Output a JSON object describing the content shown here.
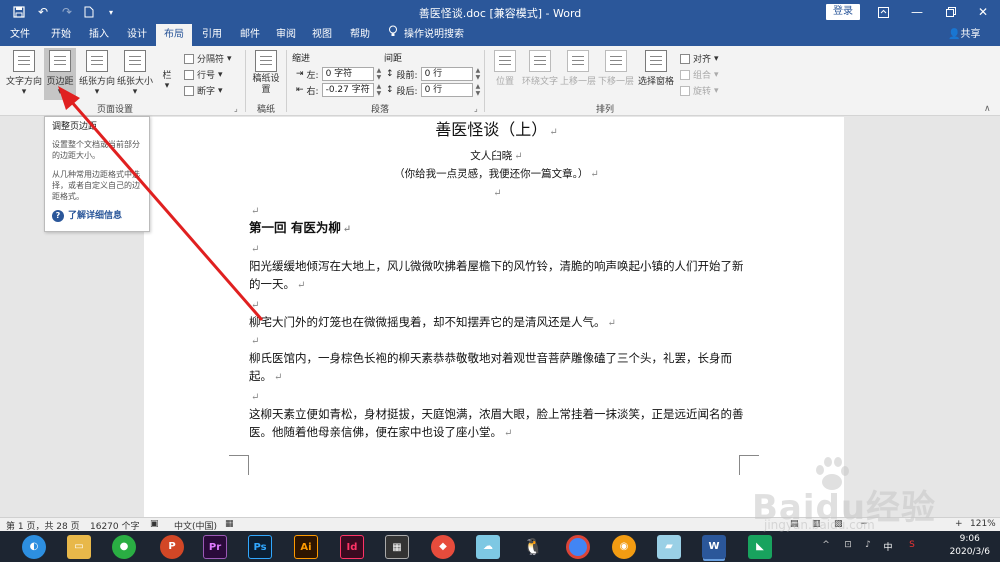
{
  "title_bar": {
    "doc_title": "善医怪谈.doc [兼容模式] - Word",
    "login": "登录",
    "icons": [
      "save-icon",
      "undo-icon",
      "redo-icon",
      "new-doc-icon",
      "customize-quick-access-icon",
      "ribbon-display-icon",
      "minimize-icon",
      "restore-icon",
      "close-icon"
    ]
  },
  "tabs": [
    "文件",
    "开始",
    "插入",
    "设计",
    "布局",
    "引用",
    "邮件",
    "审阅",
    "视图",
    "帮助"
  ],
  "active_tab": "布局",
  "search_help": "操作说明搜索",
  "share": "共享",
  "ribbon": {
    "page_setup": {
      "text_direction": "文字方向",
      "margins": "页边距",
      "orientation": "纸张方向",
      "size": "纸张大小",
      "columns": "栏",
      "breaks": "分隔符",
      "line_numbers": "行号",
      "hyphenation": "断字",
      "group_label": "页面设置"
    },
    "manuscript": {
      "label": "稿纸设置",
      "group_label": "稿纸"
    },
    "paragraph": {
      "indent_header": "缩进",
      "spacing_header": "间距",
      "left_label": "左:",
      "left_value": "0 字符",
      "right_label": "右:",
      "right_value": "-0.27 字符",
      "before_label": "段前:",
      "before_value": "0 行",
      "after_label": "段后:",
      "after_value": "0 行",
      "group_label": "段落"
    },
    "arrange": {
      "position": "位置",
      "wrap_text": "环绕文字",
      "bring_forward": "上移一层",
      "send_backward": "下移一层",
      "selection_pane": "选择窗格",
      "align": "对齐",
      "group": "组合",
      "rotate": "旋转",
      "group_label": "排列"
    }
  },
  "tooltip": {
    "title": "调整页边距",
    "p1": "设置整个文档或当前部分的边距大小。",
    "p2": "从几种常用边距格式中选择，或者自定义自己的边距格式。",
    "link": "了解详细信息"
  },
  "document": {
    "title": "善医怪谈（上）",
    "author": "文人臼晓",
    "subtitle": "（你给我一点灵感，我便还你一篇文章。）",
    "chapter": "第一回  有医为柳",
    "para1": "阳光缓缓地倾泻在大地上，风儿微微吹拂着屋檐下的风竹铃，清脆的响声唤起小镇的人们开始了新的一天。",
    "para2": "柳宅大门外的灯笼也在微微摇曳着，却不知摆弄它的是清风还是人气。",
    "para3": "柳氏医馆内，一身棕色长袍的柳天素恭恭敬敬地对着观世音菩萨雕像磕了三个头，礼罢，长身而起。",
    "para4": "这柳天素立便如青松，身材挺拔，天庭饱满，浓眉大眼，脸上常挂着一抹淡笑，正是远近闻名的善医。他随着他母亲信佛，便在家中也设了座小堂。",
    "paragraph_mark": "↵"
  },
  "status_bar": {
    "page": "第 1 页，共 28 页",
    "words": "16270 个字",
    "language": "中文(中国)",
    "zoom": "121%"
  },
  "taskbar": {
    "apps": [
      "Pr",
      "Ps",
      "Ai",
      "Id",
      "W"
    ],
    "time": "9:06",
    "date": "2020/3/6",
    "ime": "中"
  },
  "watermark": {
    "brand": "Baidu经验",
    "url": "jingyan.baidu.com"
  },
  "colors": {
    "word_blue": "#2b579a",
    "annotation_arrow": "#e02020",
    "taskbar": "#1d2531"
  }
}
